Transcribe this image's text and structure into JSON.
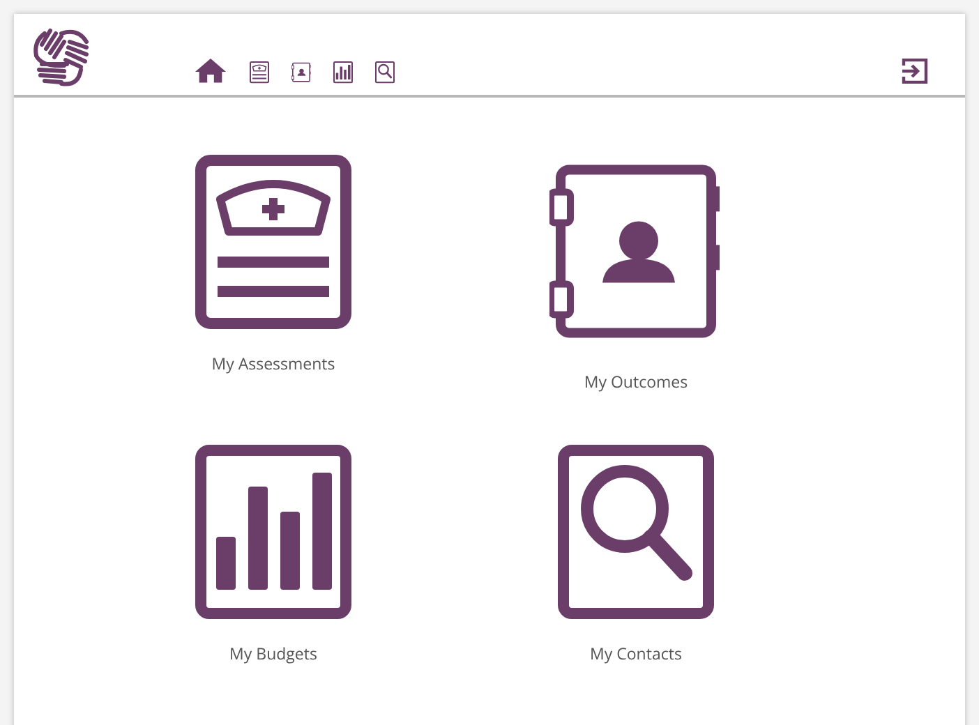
{
  "header": {
    "nav": [
      {
        "kind": "home"
      },
      {
        "kind": "assessment"
      },
      {
        "kind": "outcomes"
      },
      {
        "kind": "budgets"
      },
      {
        "kind": "contacts"
      }
    ]
  },
  "tiles": [
    {
      "kind": "assessment",
      "label": "My Assessments"
    },
    {
      "kind": "outcomes",
      "label": "My Outcomes"
    },
    {
      "kind": "budgets",
      "label": "My Budgets"
    },
    {
      "kind": "contacts",
      "label": "My Contacts"
    }
  ]
}
